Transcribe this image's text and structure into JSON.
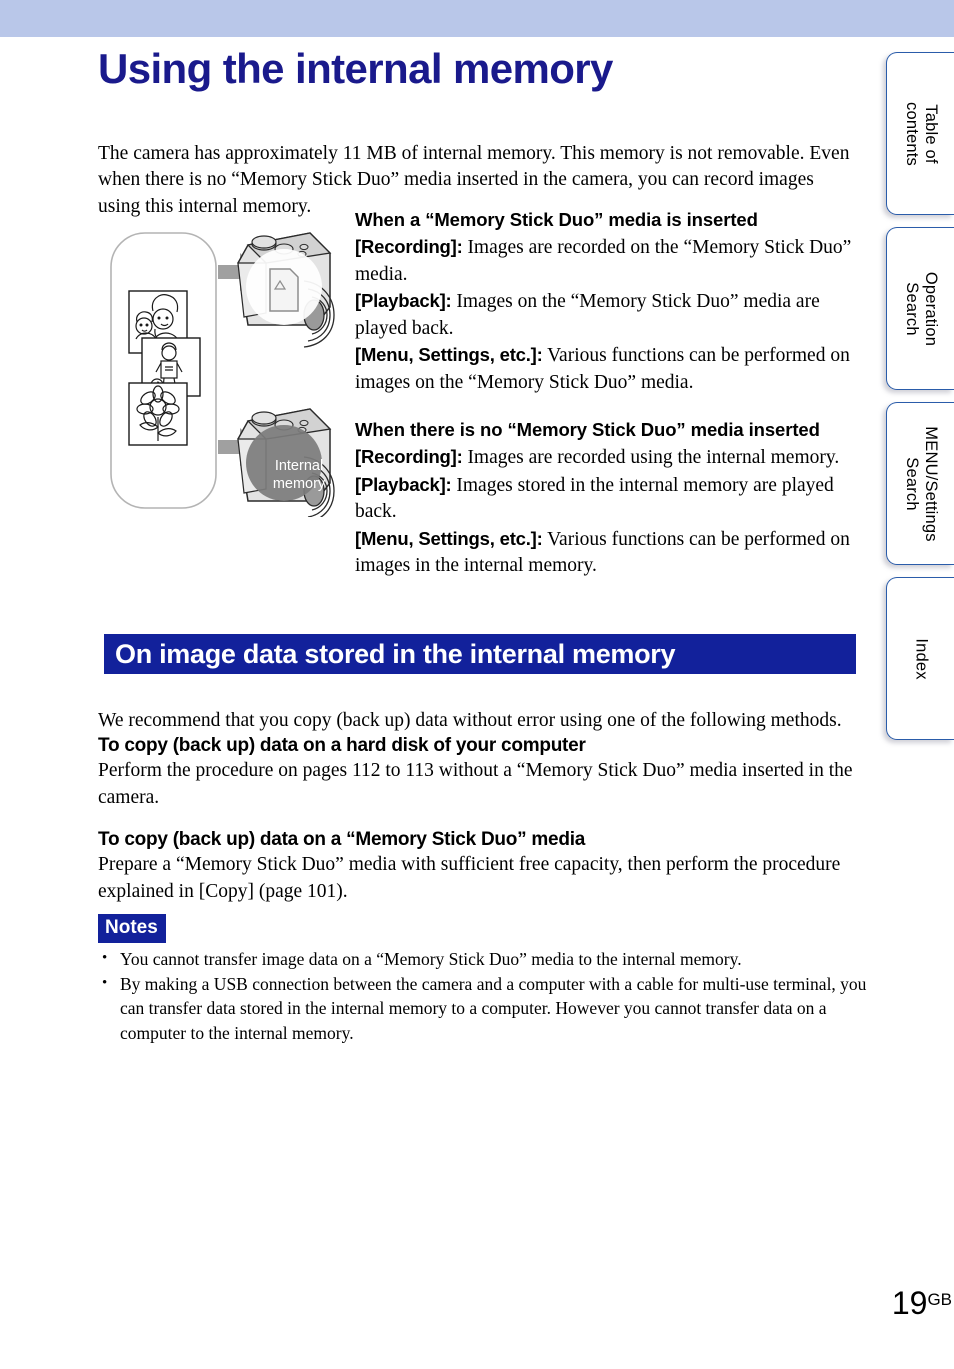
{
  "document": {
    "title": "Using the internal memory",
    "page_number": "19",
    "page_suffix": "GB"
  },
  "tabs": [
    {
      "name": "table-of-contents",
      "line1": "Table of",
      "line2": "contents"
    },
    {
      "name": "operation-search",
      "line1": "Operation",
      "line2": "Search"
    },
    {
      "name": "menu-settings-search",
      "line1": "MENU/Settings",
      "line2": "Search"
    },
    {
      "name": "index",
      "line1": "Index",
      "line2": ""
    }
  ],
  "intro": "The camera has approximately 11 MB of internal memory. This memory is not removable. Even when there is no “Memory Stick Duo” media inserted in the camera, you can record images using this internal memory.",
  "illustration": {
    "internal_memory_label_line1": "Internal",
    "internal_memory_label_line2": "memory",
    "alt": "Images flow from a photo stack into a camera with a Memory Stick Duo media inserted, and into a camera using internal memory"
  },
  "inserted_section": {
    "heading": "When a “Memory Stick Duo” media is inserted",
    "items": [
      {
        "label": "[Recording]:",
        "text": " Images are recorded on the “Memory Stick Duo” media."
      },
      {
        "label": "[Playback]:",
        "text": " Images on the “Memory Stick Duo” media are played back."
      },
      {
        "label": "[Menu, Settings, etc.]:",
        "text": " Various functions can be performed on images on the “Memory Stick Duo” media."
      }
    ]
  },
  "no_media_section": {
    "heading": "When there is no “Memory Stick Duo” media inserted",
    "items": [
      {
        "label": "[Recording]:",
        "text": " Images are recorded using the internal memory."
      },
      {
        "label": "[Playback]:",
        "text": " Images stored in the internal memory are played back."
      },
      {
        "label": "[Menu, Settings, etc.]:",
        "text": " Various functions can be performed on images in the internal memory."
      }
    ]
  },
  "section_bar": {
    "title": "On image data stored in the internal memory",
    "color": "#12219b"
  },
  "recommendation": "We recommend that you copy (back up) data without error using one of the following methods.",
  "copy_hard_disk": {
    "heading": "To copy (back up) data on a hard disk of your computer",
    "body": "Perform the procedure on pages 112 to 113 without a “Memory Stick Duo” media inserted in the camera."
  },
  "copy_memory_stick": {
    "heading": "To copy (back up) data on a “Memory Stick Duo” media",
    "body": "Prepare a “Memory Stick Duo” media with sufficient free capacity, then perform the procedure explained in [Copy] (page 101)."
  },
  "notes": {
    "badge": "Notes",
    "items": [
      "You cannot transfer image data on a “Memory Stick Duo” media to the internal memory.",
      "By making a USB connection between the camera and a computer with a cable for multi-use terminal, you can transfer data stored in the internal memory to a computer. However you cannot transfer data on a computer to the internal memory."
    ]
  },
  "colors": {
    "top_band": "#b9c7e9",
    "title_blue": "#1a1a8c",
    "accent_blue": "#12219b",
    "tab_border": "#2a5caa"
  }
}
